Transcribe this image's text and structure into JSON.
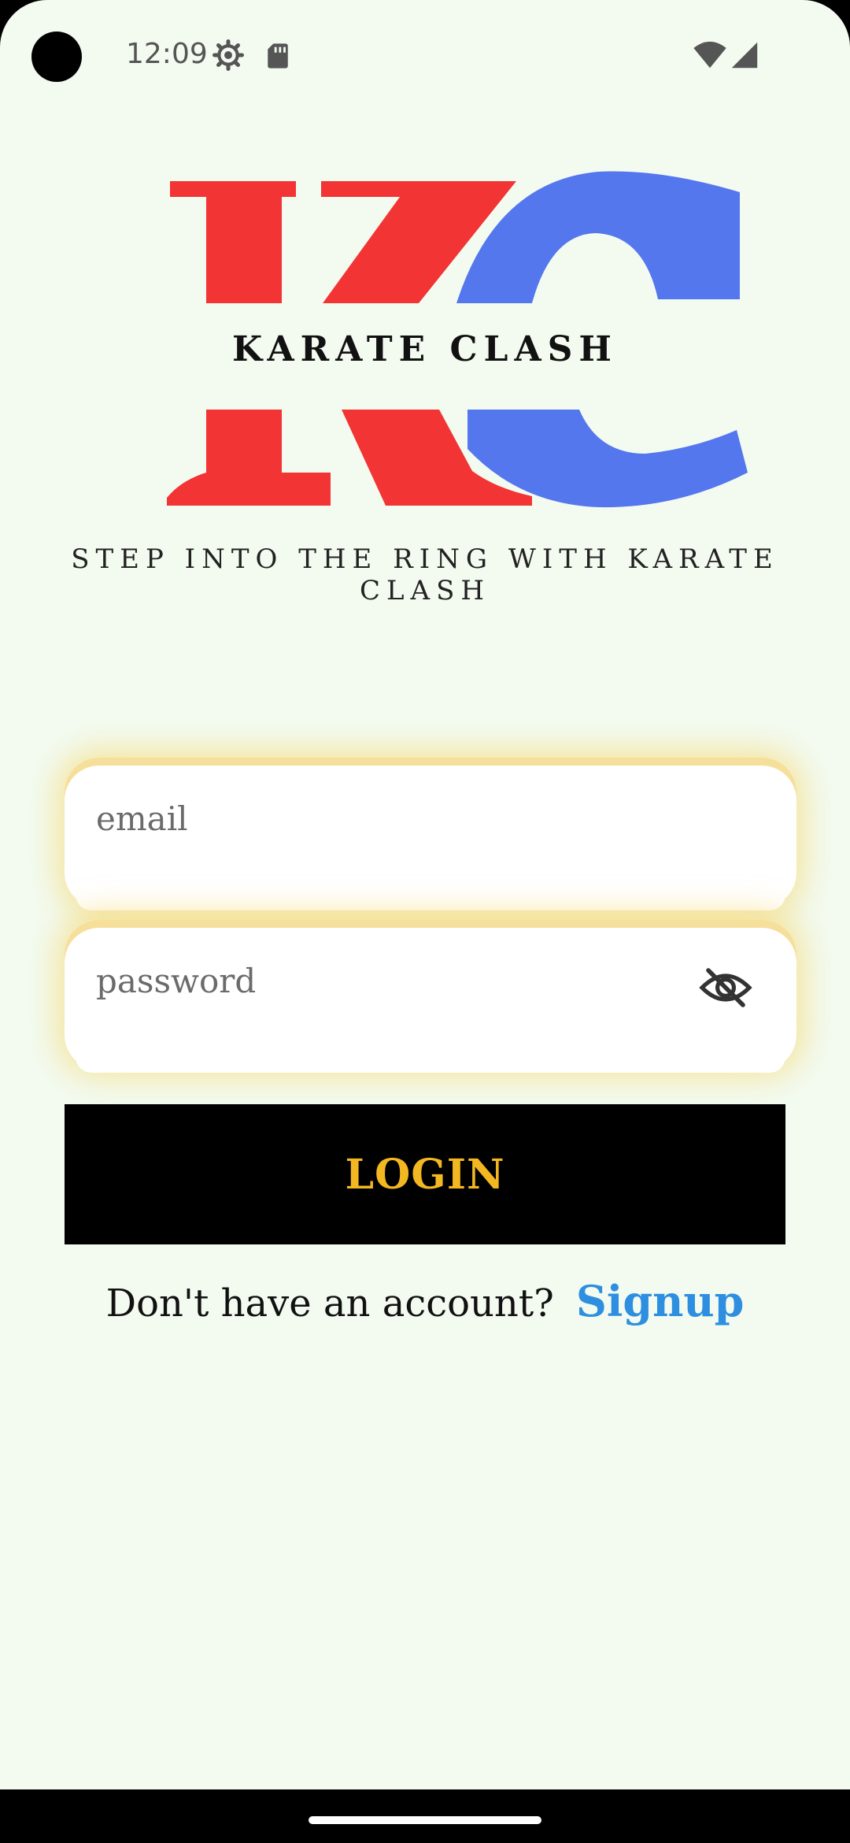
{
  "status_bar": {
    "time": "12:09",
    "icons": [
      "gear-icon",
      "sd-card-icon",
      "wifi-icon",
      "signal-icon"
    ]
  },
  "logo": {
    "monogram": "KC",
    "wordmark": "KARATE CLASH",
    "colors": {
      "k": "#f23434",
      "c": "#5577ee"
    }
  },
  "tagline": "STEP INTO THE RING WITH KARATE CLASH",
  "form": {
    "email": {
      "placeholder": "email",
      "value": ""
    },
    "password": {
      "placeholder": "password",
      "value": "",
      "toggle_icon": "eye-off-icon"
    },
    "login_label": "LOGIN"
  },
  "signup": {
    "prompt": "Don't have an account?",
    "link_label": "Signup"
  },
  "colors": {
    "background": "#f3fbf1",
    "field_glow": "#f5d25a",
    "button_bg": "#000000",
    "button_text": "#f3b821",
    "link": "#2e8fe0"
  }
}
